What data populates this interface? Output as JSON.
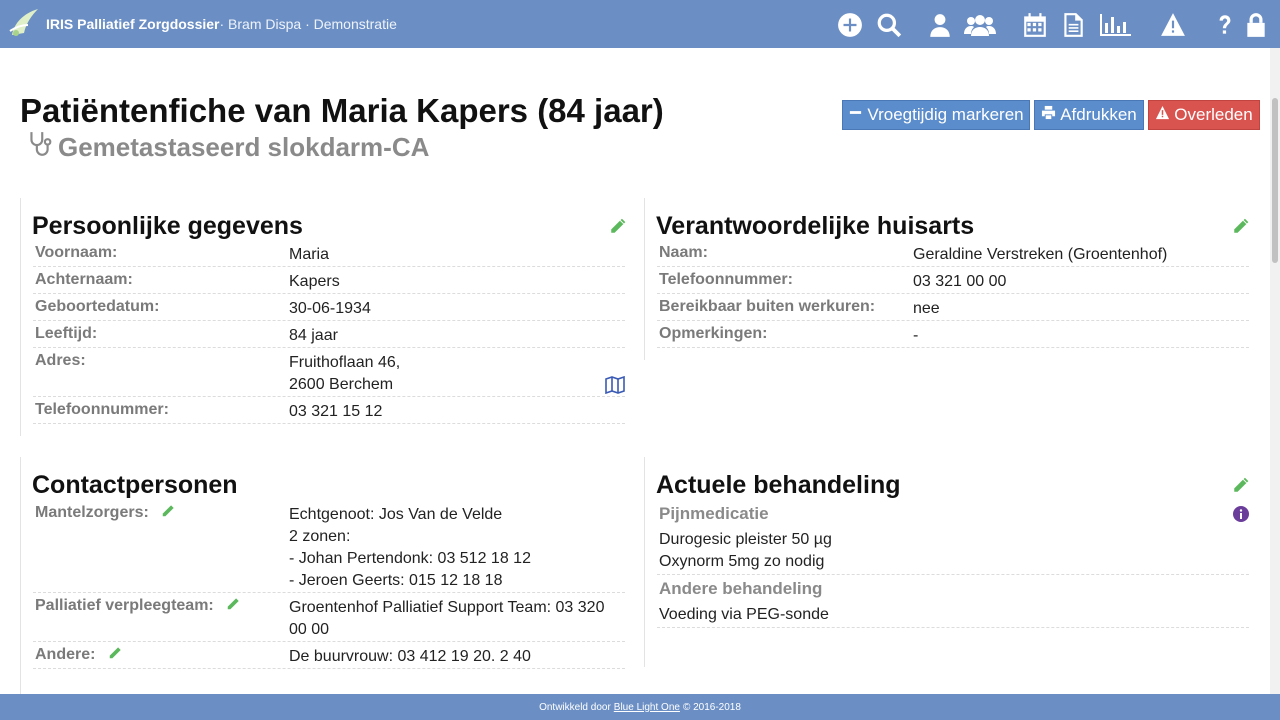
{
  "app": {
    "title": "IRIS Palliatief Zorgdossier",
    "subtitle": " · Bram Dispa · Demonstratie"
  },
  "nav_icons": [
    "plus-circle-icon",
    "search-icon",
    "user-icon",
    "users-icon",
    "calendar-icon",
    "document-icon",
    "bar-chart-icon",
    "warning-icon",
    "question-icon",
    "lock-icon"
  ],
  "header": {
    "title": "Patiëntenfiche van Maria Kapers (84 jaar)",
    "diagnosis": "Gemetastaseerd slokdarm-CA"
  },
  "actions": {
    "mark_early": "Vroegtijdig markeren",
    "print": "Afdrukken",
    "deceased": "Overleden"
  },
  "personal": {
    "title": "Persoonlijke gegevens",
    "rows": [
      {
        "label": "Voornaam:",
        "value": "Maria"
      },
      {
        "label": "Achternaam:",
        "value": "Kapers"
      },
      {
        "label": "Geboortedatum:",
        "value": "30-06-1934"
      },
      {
        "label": "Leeftijd:",
        "value": "84 jaar"
      },
      {
        "label": "Adres:",
        "value_line1": "Fruithoflaan 46,",
        "value_line2": "2600 Berchem"
      },
      {
        "label": "Telefoonnummer:",
        "value": "03 321 15 12"
      }
    ]
  },
  "gp": {
    "title": "Verantwoordelijke huisarts",
    "rows": [
      {
        "label": "Naam:",
        "value": "Geraldine Verstreken (Groentenhof)"
      },
      {
        "label": "Telefoonnummer:",
        "value": "03 321 00 00"
      },
      {
        "label": "Bereikbaar buiten werkuren:",
        "value": "nee"
      },
      {
        "label": "Opmerkingen:",
        "value": "-"
      }
    ]
  },
  "contacts": {
    "title": "Contactpersonen",
    "rows": [
      {
        "label": "Mantelzorgers:",
        "lines": [
          "Echtgenoot: Jos Van de Velde",
          "2 zonen:",
          "- Johan Pertendonk: 03 512 18 12",
          "- Jeroen Geerts: 015 12 18 18"
        ]
      },
      {
        "label": "Palliatief verpleegteam:",
        "lines": [
          "Groentenhof Palliatief Support Team: 03 320",
          "00 00"
        ]
      },
      {
        "label": "Andere:",
        "lines": [
          "De buurvrouw: 03 412 19 20. 2 40"
        ]
      }
    ]
  },
  "treatment": {
    "title": "Actuele behandeling",
    "pain_label": "Pijnmedicatie",
    "pain_lines": [
      "Durogesic pleister 50 µg",
      "Oxynorm 5mg zo nodig"
    ],
    "other_label": "Andere behandeling",
    "other_lines": [
      "Voeding via PEG-sonde"
    ]
  },
  "footer": {
    "prefix": "Ontwikkeld door",
    "link": "Blue Light One",
    "suffix": "© 2016-2018"
  },
  "colors": {
    "topbar": "#6b8fc4",
    "button_blue": "#5b8ccc",
    "button_red": "#d9534f",
    "edit_green": "#5cb85c",
    "info_purple": "#6a3d9a"
  }
}
